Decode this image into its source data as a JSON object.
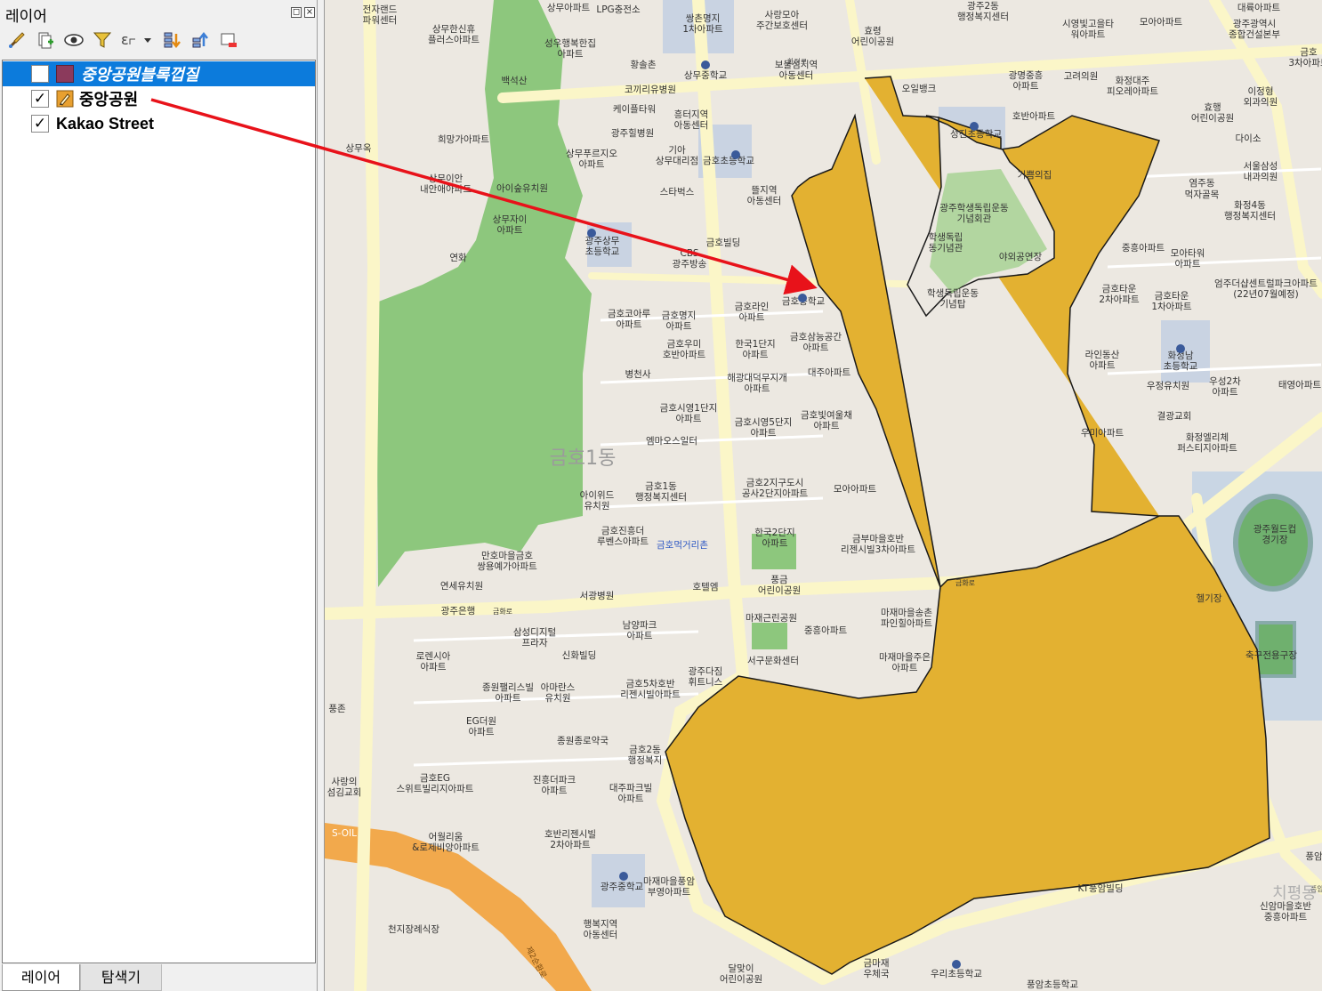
{
  "panel": {
    "title": "레이어",
    "float_icon": "float-icon",
    "close_icon": "close-icon",
    "toolbar": [
      "style-brush-icon",
      "add-group-icon",
      "eye-visibility-icon",
      "filter-icon",
      "expression-filter-icon",
      "expand-all-icon",
      "collapse-all-icon",
      "remove-layer-icon"
    ]
  },
  "layers": [
    {
      "name": "중앙공원블록껍질",
      "checked": false,
      "selected": true,
      "symbol_color": "#8b3a5c"
    },
    {
      "name": "중앙공원",
      "checked": true,
      "selected": false,
      "symbol_color": "#e8a030"
    },
    {
      "name": "Kakao Street",
      "checked": true,
      "selected": false,
      "symbol_color": ""
    }
  ],
  "tabs": [
    {
      "label": "레이어",
      "active": true
    },
    {
      "label": "탐색기",
      "active": false
    }
  ],
  "colors": {
    "polygon_fill": "#e3b131",
    "polygon_stroke": "#1a1a1a",
    "arrow": "#e8121a",
    "park": "#8dc77d",
    "road": "#fbf6c8",
    "highway": "#f2a94c"
  },
  "map": {
    "district_label": "금호1동",
    "district_label_2": "치평동",
    "labels": {
      "l1": "전자랜드",
      "l2": "파워센터",
      "l3": "상무아파트",
      "l4": "LPG충전소",
      "l5": "쌍촌명지",
      "l6": "1차아파트",
      "l7": "사랑모아",
      "l8": "주간보호센터",
      "l9": "효령",
      "l10": "어린이공원",
      "l11": "광주2동",
      "l12": "행정복지센터",
      "l13": "시영빛고을타",
      "l14": "워아파트",
      "l15": "모아아파트",
      "l16": "대륙아파트",
      "l17": "광주광역시",
      "l18": "종합건설본부",
      "l19": "상무한신휴",
      "l20": "플러스아파트",
      "l21": "성우행복한집",
      "l22": "아파트",
      "l23": "황솔촌",
      "l24": "상무중학교",
      "l25": "보물섬지역",
      "l26": "아동센터",
      "l27": "광명중흥",
      "l28": "아파트",
      "l29": "고려의원",
      "l30": "화정대주",
      "l31": "피오레아파트",
      "l32": "금호",
      "l33": "3차아파트",
      "l34": "백석산",
      "l35": "코끼리유병원",
      "l36": "오일뱅크",
      "l37": "효행",
      "l38": "어린이공원",
      "l39": "이정형",
      "l40": "외과의원",
      "l41": "케이플타워",
      "l42": "흥터지역",
      "l43": "아동센터",
      "l44": "광주힐병원",
      "l45": "성진초등학교",
      "l46": "호반아파트",
      "l47": "다이소",
      "l48": "희망가아파트",
      "l49": "상무푸르지오",
      "l50": "아파트",
      "l51": "기아",
      "l52": "상무대리점",
      "l53": "금호초등학교",
      "l54": "상무옥",
      "l55": "서울삼성",
      "l56": "내과의원",
      "l57": "상무이안",
      "l58": "내안애아파트",
      "l59": "아이숲유치원",
      "l60": "스타벅스",
      "l61": "뜰지역",
      "l62": "아동센터",
      "l63": "기쁨의집",
      "l64": "광주학생독립운동",
      "l65": "기념회관",
      "l66": "염주동",
      "l67": "먹자골목",
      "l68": "화정4동",
      "l69": "행정복지센터",
      "l70": "상무자이",
      "l71": "아파트",
      "l72": "광주상무",
      "l73": "초등학교",
      "l74": "CBS",
      "l75": "광주방송",
      "l76": "금호빌딩",
      "l77": "학생독립",
      "l78": "동기념관",
      "l79": "야외공연장",
      "l80": "중흥아파트",
      "l81": "모아타워",
      "l82": "아파트",
      "l83": "연화",
      "l84": "엄주더샵센트럴파크아파트",
      "l85": "(22년07월예정)",
      "l86": "금호코아루",
      "l87": "아파트",
      "l88": "금호명지",
      "l89": "아파트",
      "l90": "금호라인",
      "l91": "아파트",
      "l92": "금호중학교",
      "l93": "학생독립운동",
      "l94": "기념탑",
      "l95": "금호타운",
      "l96": "2차아파트",
      "l97": "금호타운",
      "l98": "1차아파트",
      "l99": "금호우미",
      "l100": "호반아파트",
      "l101": "한국1단지",
      "l102": "아파트",
      "l103": "금호삼능공간",
      "l104": "아파트",
      "l105": "라인동산",
      "l106": "아파트",
      "l107": "화정남",
      "l108": "초등학교",
      "l109": "병천사",
      "l110": "해광대덕무지개",
      "l111": "아파트",
      "l112": "대주아파트",
      "l113": "우정유치원",
      "l114": "우성2차",
      "l115": "아파트",
      "l116": "태영아파트",
      "l117": "금호시영1단지",
      "l118": "아파트",
      "l119": "금호시영5단지",
      "l120": "아파트",
      "l121": "금호빛여울채",
      "l122": "아파트",
      "l123": "결광교회",
      "l124": "엠마오스일터",
      "l125": "우미아파트",
      "l126": "화정엘리체",
      "l127": "퍼스티지아파트",
      "l128": "아이위드",
      "l129": "유치원",
      "l130": "금호1동",
      "l131": "행정복지센터",
      "l132": "금호2지구도시",
      "l133": "공사2단지아파트",
      "l134": "모아아파트",
      "l135": "광주월드컵",
      "l136": "경기장",
      "l137": "금호진흥더",
      "l138": "루벤스아파트",
      "l139": "금호먹거리촌",
      "l140": "한국2단지",
      "l141": "아파트",
      "l142": "금부마을호반",
      "l143": "리젠시빌3차아파트",
      "l144": "만호마을금호",
      "l145": "쌍용예가아파트",
      "l146": "연세유치원",
      "l147": "서광병원",
      "l148": "호텔엠",
      "l149": "풍금",
      "l150": "어린이공원",
      "l151": "헬기장",
      "l152": "광주은행",
      "l153": "금화로",
      "l154": "금화로",
      "l155": "삼성디지털",
      "l156": "프라자",
      "l157": "남양파크",
      "l158": "아파트",
      "l159": "마재근린공원",
      "l160": "마재마을송촌",
      "l161": "파인힐아파트",
      "l162": "중흥아파트",
      "l163": "로렌시아",
      "l164": "아파트",
      "l165": "신화빌딩",
      "l166": "축구전용구장",
      "l167": "종원팰리스빌",
      "l168": "아파트",
      "l169": "아마란스",
      "l170": "유치원",
      "l171": "금호5차호반",
      "l172": "리젠시빌아파트",
      "l173": "광주다짐",
      "l174": "휘트니스",
      "l175": "서구문화센터",
      "l176": "마재마을주은",
      "l177": "아파트",
      "l178": "EG더원",
      "l179": "아파트",
      "l180": "풍존",
      "l181": "종원종로약국",
      "l182": "금호2동",
      "l183": "행정복지",
      "l184": "사랑의",
      "l185": "섬김교회",
      "l186": "금호EG",
      "l187": "스위트빌리지아파트",
      "l188": "진흥더파크",
      "l189": "아파트",
      "l190": "대주파크빌",
      "l191": "아파트",
      "l192": "S-OIL",
      "l193": "어월리움",
      "l194": "&로제비앙아파트",
      "l195": "호반리젠시빌",
      "l196": "2차아파트",
      "l197": "마재마을풍암",
      "l198": "부영아파트",
      "l199": "광주중학교",
      "l200": "KT풍암빌딩",
      "l201": "풍암",
      "l202": "신암마을호반",
      "l203": "중흥아파트",
      "l204": "천지장례식장",
      "l205": "행복지역",
      "l206": "아동센터",
      "l207": "달맞이",
      "l208": "어린이공원",
      "l209": "금마재",
      "l210": "우체국",
      "l211": "우리초등학교",
      "l212": "풍암초등학교",
      "l213": "제2순환로",
      "l214": "화정로",
      "l215": "풍암"
    }
  }
}
